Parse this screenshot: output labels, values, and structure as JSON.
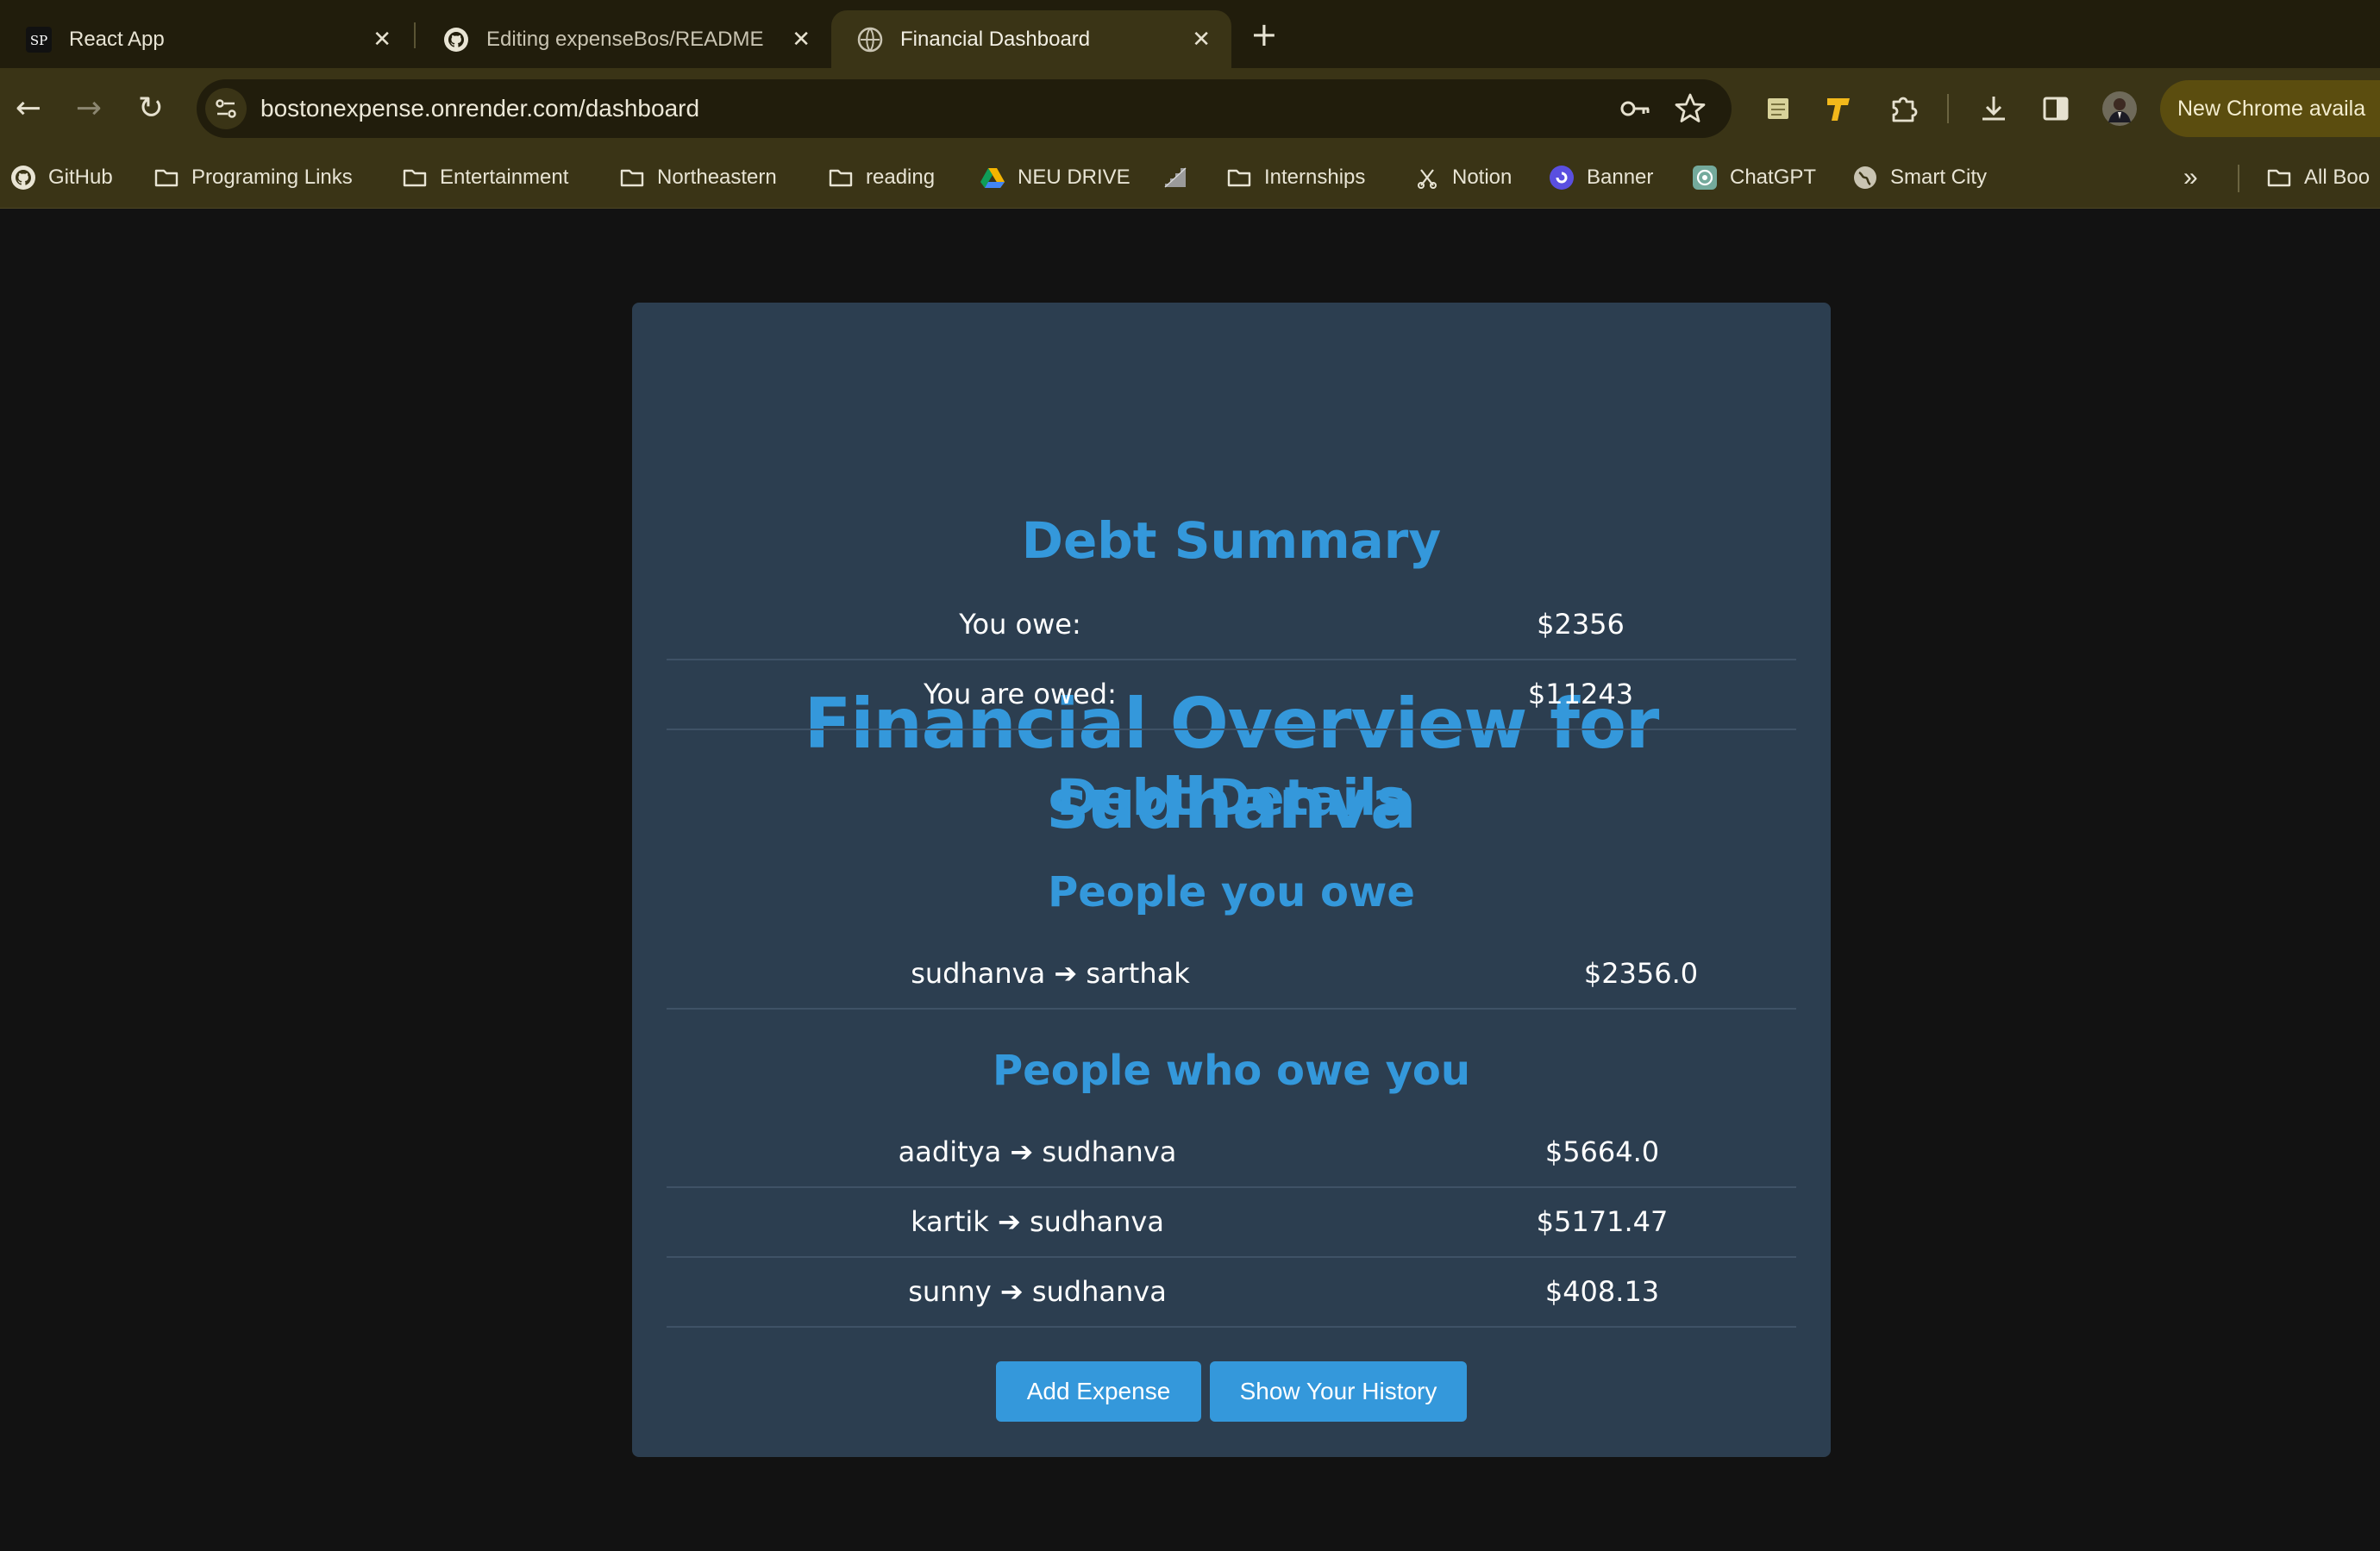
{
  "browser": {
    "tabs": [
      {
        "title": "React App",
        "favicon": "react-app-favicon",
        "active": false
      },
      {
        "title": "Editing expenseBos/README",
        "favicon": "github-icon",
        "active": false
      },
      {
        "title": "Financial Dashboard",
        "favicon": "globe-icon",
        "active": true
      }
    ],
    "url": "bostonexpense.onrender.com/dashboard",
    "update_pill": "New Chrome availa",
    "bookmarks": [
      {
        "label": "GitHub",
        "icon": "github-icon"
      },
      {
        "label": "Programing Links",
        "icon": "folder-icon"
      },
      {
        "label": "Entertainment",
        "icon": "folder-icon"
      },
      {
        "label": "Northeastern",
        "icon": "folder-icon"
      },
      {
        "label": "reading",
        "icon": "folder-icon"
      },
      {
        "label": "NEU DRIVE",
        "icon": "google-drive-icon"
      },
      {
        "label": "",
        "icon": "stairs-icon"
      },
      {
        "label": "Internships",
        "icon": "folder-icon"
      },
      {
        "label": "Notion",
        "icon": "notion-icon"
      },
      {
        "label": "Banner",
        "icon": "banner-icon"
      },
      {
        "label": "ChatGPT",
        "icon": "chatgpt-icon"
      },
      {
        "label": "Smart City",
        "icon": "globe-icon"
      }
    ],
    "all_bookmarks": "All Boo",
    "accent_colors": {
      "tab_bar": "#211d0c",
      "toolbar": "#3a3416"
    }
  },
  "dashboard": {
    "title": "Financial Overview for sudhanva",
    "summary_heading": "Debt Summary",
    "summary": [
      {
        "label": "You owe:",
        "value": "$2356"
      },
      {
        "label": "You are owed:",
        "value": "$11243"
      }
    ],
    "details_heading": "Debt Details",
    "owe_heading": "People you owe",
    "owe": [
      {
        "label": "sudhanva ➔ sarthak",
        "value": "$2356.0"
      }
    ],
    "owed_heading": "People who owe you",
    "owed": [
      {
        "label": "aaditya ➔ sudhanva",
        "value": "$5664.0"
      },
      {
        "label": "kartik ➔ sudhanva",
        "value": "$5171.47"
      },
      {
        "label": "sunny ➔ sudhanva",
        "value": "$408.13"
      }
    ],
    "buttons": {
      "add": "Add Expense",
      "history": "Show Your History"
    },
    "colors": {
      "card": "#2c3e50",
      "accent": "#3498db",
      "background": "#121212"
    }
  }
}
